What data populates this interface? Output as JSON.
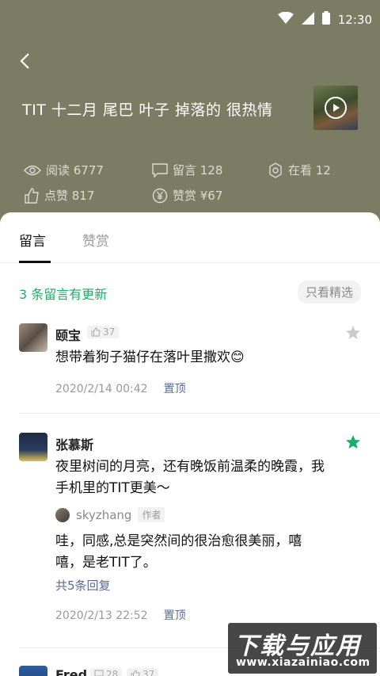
{
  "status_bar": {
    "time": "12:30"
  },
  "article": {
    "title": "TIT 十二月 尾巴 叶子 掉落的 很热情",
    "stats": {
      "reads": "阅读 6777",
      "comments": "留言 128",
      "watching": "在看 12",
      "likes": "点赞 817",
      "rewards": "赞赏 ¥67"
    }
  },
  "tabs": [
    {
      "label": "留言"
    },
    {
      "label": "赞赏"
    }
  ],
  "updates_text": "3 条留言有更新",
  "filter_label": "只看精选",
  "comments": [
    {
      "name": "颐宝",
      "like_count": "37",
      "text": "想带着狗子猫仔在落叶里撒欢😊",
      "time": "2020/2/14  00:42",
      "pin_label": "置顶"
    },
    {
      "name": "张慕斯",
      "text": "夜里树间的月亮，还有晚饭前温柔的晚霞，我手机里的TIT更美～",
      "reply": {
        "name": "skyzhang",
        "tag": "作者",
        "text": "哇，同感,总是突然间的很治愈很美丽，嘻嘻，是老TIT了。"
      },
      "reply_count": "共5条回复",
      "time": "2020/2/13  22:52",
      "pin_label": "置顶"
    },
    {
      "name": "Fred",
      "comment_count": "28",
      "like_count": "37"
    }
  ],
  "watermark": {
    "main": "下载与应用",
    "sub": "www.xiazainiao.com"
  },
  "colors": {
    "header_bg": "#7a7d63",
    "accent_green": "#1aad6a",
    "link_blue": "#576b95",
    "star_starred": "#1aad6a",
    "star_unstarred": "#cccccc"
  }
}
